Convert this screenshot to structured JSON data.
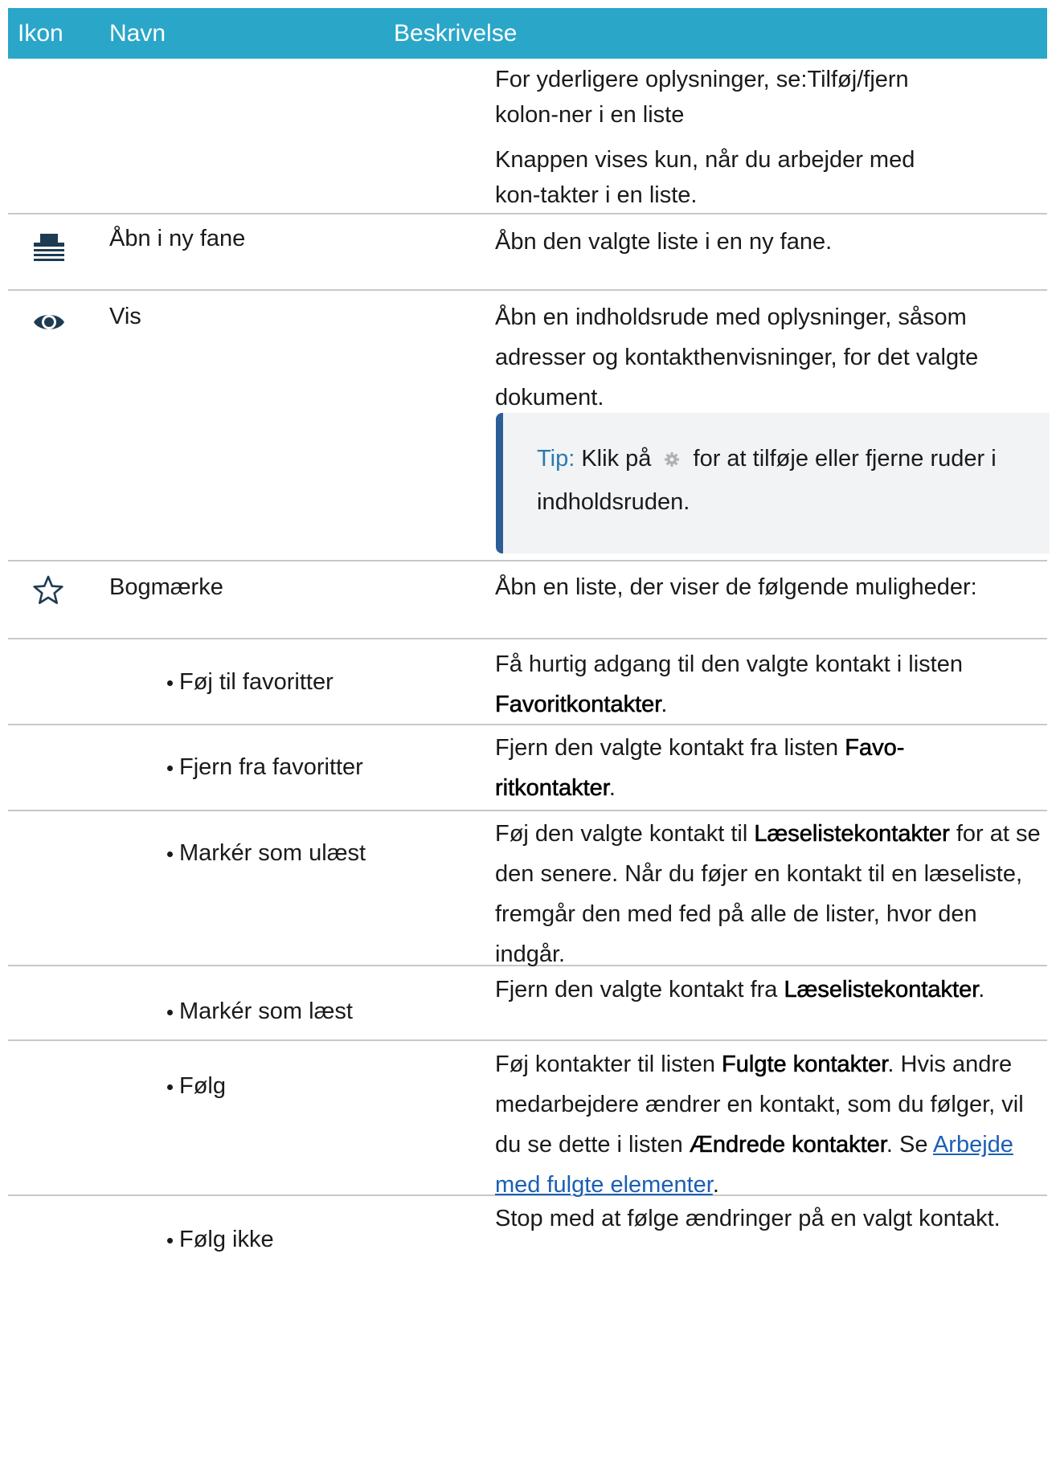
{
  "colors": {
    "accent": "#2aa6c9"
  },
  "header": {
    "icon": "Ikon",
    "name": "Navn",
    "description": "Beskrivelse"
  },
  "rows": [
    {
      "paragraphs": [
        "For yderligere oplysninger, se:Tilføj/fjern kolon-ner i en liste",
        "Knappen vises kun, når du arbejder med kon-takter i en liste."
      ]
    },
    {
      "icon": "open-in-new-tab-icon",
      "name": "Åbn i ny fane",
      "description": "Åbn den valgte liste i en ny fane."
    },
    {
      "icon": "eye-icon",
      "name": "Vis",
      "description": "Åbn en indholdsrude med oplysninger, såsom adresser og kontakthenvisninger, for det valgte dokument.",
      "tip": {
        "label": "Tip:",
        "before": "Klik på",
        "icon": "gear-icon",
        "after": "for at tilføje eller fjerne ruder i indholdsruden."
      }
    },
    {
      "icon": "star-icon",
      "name": "Bogmærke",
      "description": "Åbn en liste, der viser de følgende muligheder:"
    },
    {
      "name": "Føj til favoritter",
      "desc_before": "Få hurtig adgang til den valgte kontakt i listen",
      "desc_bold": "Favoritkontakter",
      "desc_after": "."
    },
    {
      "name": "Fjern fra favoritter",
      "desc_before": "Fjern den valgte kontakt fra listen",
      "desc_bold": "Favo-ritkontakter",
      "desc_after": "."
    },
    {
      "name": "Markér som ulæst",
      "desc_before": "Føj den valgte kontakt til",
      "desc_bold": "Læselistekontakter",
      "desc_after": "for at se den senere. Når du føjer en kontakt til en læseliste, fremgår den med fed på alle de lister, hvor den indgår."
    },
    {
      "name": "Markér som læst",
      "desc_before": "Fjern den valgte kontakt fra",
      "desc_bold": "Læselistekontakter",
      "desc_after": "."
    },
    {
      "name": "Følg",
      "desc_before": "Føj kontakter til listen",
      "desc_bold": "Fulgte kontakter",
      "desc_mid": ". Hvis andre medarbejdere ændrer en kontakt, som du følger, vil du se dette i listen",
      "desc_bold2": "Ændrede kontakter",
      "desc_mid2": ". Se",
      "desc_link": "Arbejde med fulgte elementer",
      "desc_after": "."
    },
    {
      "name": "Følg ikke",
      "description": "Stop med at følge ændringer på en valgt kontakt."
    }
  ]
}
